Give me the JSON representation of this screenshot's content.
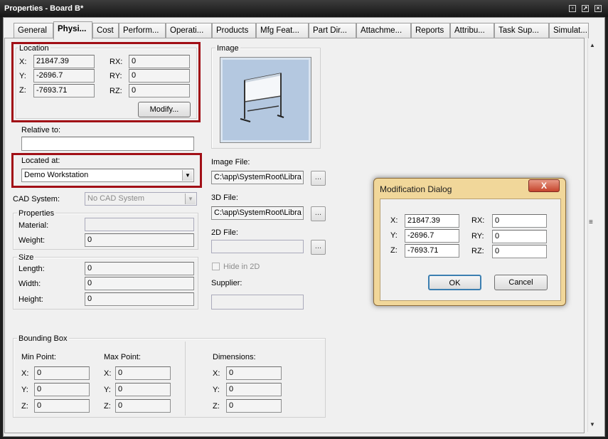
{
  "window": {
    "title": "Properties - Board B*"
  },
  "tabs": [
    "General",
    "Physi...",
    "Cost",
    "Perform...",
    "Operati...",
    "Products",
    "Mfg Feat...",
    "Part Dir...",
    "Attachme...",
    "Reports",
    "Attribu...",
    "Task Sup...",
    "Simulat..."
  ],
  "active_tab": "Physi...",
  "location": {
    "title": "Location",
    "x_label": "X:",
    "x": "21847.39",
    "y_label": "Y:",
    "y": "-2696.7",
    "z_label": "Z:",
    "z": "-7693.71",
    "rx_label": "RX:",
    "rx": "0",
    "ry_label": "RY:",
    "ry": "0",
    "rz_label": "RZ:",
    "rz": "0",
    "modify_button": "Modify..."
  },
  "relative_to": {
    "label": "Relative to:",
    "value": ""
  },
  "located_at": {
    "label": "Located at:",
    "value": "Demo Workstation"
  },
  "cad_system": {
    "label": "CAD System:",
    "value": "No CAD System"
  },
  "properties": {
    "title": "Properties",
    "material_label": "Material:",
    "material": "",
    "weight_label": "Weight:",
    "weight": "0"
  },
  "size": {
    "title": "Size",
    "length_label": "Length:",
    "length": "0",
    "width_label": "Width:",
    "width": "0",
    "height_label": "Height:",
    "height": "0"
  },
  "image": {
    "title": "Image",
    "image_file_label": "Image File:",
    "image_file": "C:\\app\\SystemRoot\\Libra",
    "file3d_label": "3D File:",
    "file3d": "C:\\app\\SystemRoot\\Libra",
    "file2d_label": "2D File:",
    "file2d": "",
    "hide_in_2d": "Hide in 2D",
    "supplier_label": "Supplier:",
    "supplier": "",
    "browse": "..."
  },
  "bounding_box": {
    "title": "Bounding Box",
    "min_label": "Min Point:",
    "max_label": "Max Point:",
    "dims_label": "Dimensions:",
    "x_label": "X:",
    "y_label": "Y:",
    "z_label": "Z:",
    "min": [
      "0",
      "0",
      "0"
    ],
    "max": [
      "0",
      "0",
      "0"
    ],
    "dims": [
      "0",
      "0",
      "0"
    ]
  },
  "dialog": {
    "title": "Modification Dialog",
    "close": "X",
    "x_label": "X:",
    "x": "21847.39",
    "y_label": "Y:",
    "y": "-2696.7",
    "z_label": "Z:",
    "z": "-7693.71",
    "rx_label": "RX:",
    "rx": "0",
    "ry_label": "RY:",
    "ry": "0",
    "rz_label": "RZ:",
    "rz": "0",
    "ok": "OK",
    "cancel": "Cancel"
  },
  "colors": {
    "highlight_box": "#a10f16",
    "dialog_frame": "#f1d79a",
    "image_bg": "#b4c8e0"
  }
}
